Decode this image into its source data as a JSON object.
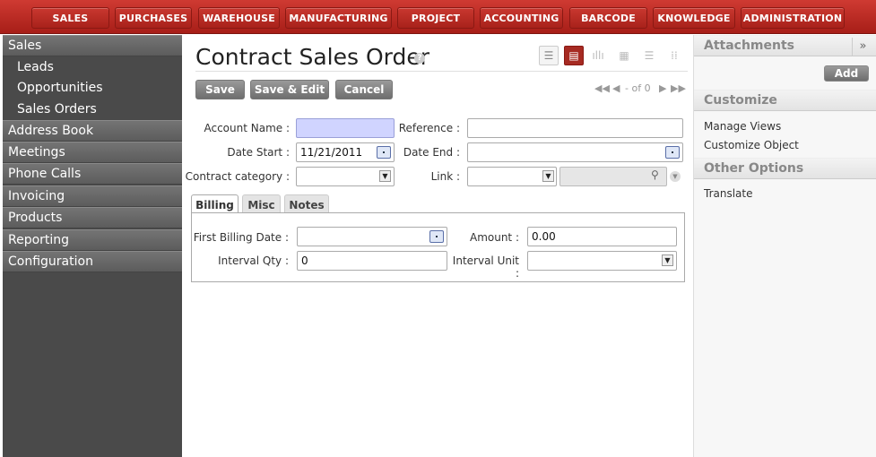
{
  "top_menu": [
    "SALES",
    "PURCHASES",
    "WAREHOUSE",
    "MANUFACTURING",
    "PROJECT",
    "ACCOUNTING",
    "BARCODE",
    "KNOWLEDGE",
    "ADMINISTRATION"
  ],
  "sidebar": {
    "section_title": "Sales",
    "sub_items": [
      "Leads",
      "Opportunities",
      "Sales Orders"
    ],
    "items": [
      "Address Book",
      "Meetings",
      "Phone Calls",
      "Invoicing",
      "Products",
      "Reporting",
      "Configuration"
    ]
  },
  "main": {
    "title": "Contract Sales Order",
    "help": "?",
    "buttons": {
      "save": "Save",
      "save_edit": "Save & Edit",
      "cancel": "Cancel"
    },
    "pager": "- of 0",
    "fields": {
      "account_name_label": "Account Name :",
      "account_name_value": "",
      "reference_label": "Reference :",
      "reference_value": "",
      "date_start_label": "Date Start :",
      "date_start_value": "11/21/2011",
      "date_end_label": "Date End :",
      "date_end_value": "",
      "contract_category_label": "Contract category :",
      "contract_category_value": "",
      "link_label": "Link :",
      "link_value": ""
    },
    "tabs": [
      "Billing",
      "Misc",
      "Notes"
    ],
    "billing": {
      "first_billing_date_label": "First Billing Date :",
      "first_billing_date_value": "",
      "amount_label": "Amount :",
      "amount_value": "0.00",
      "interval_qty_label": "Interval Qty :",
      "interval_qty_value": "0",
      "interval_unit_label": "Interval Unit :",
      "interval_unit_value": ""
    }
  },
  "right_sidebar": {
    "attachments_title": "Attachments",
    "add_label": "Add",
    "customize_title": "Customize",
    "manage_views": "Manage Views",
    "customize_object": "Customize Object",
    "other_options_title": "Other Options",
    "translate": "Translate",
    "collapse_icon": "»"
  },
  "colors": {
    "brand_red": "#b3261e",
    "required_field": "#d0d4ff",
    "sidebar_dark": "#4a4a4a"
  }
}
